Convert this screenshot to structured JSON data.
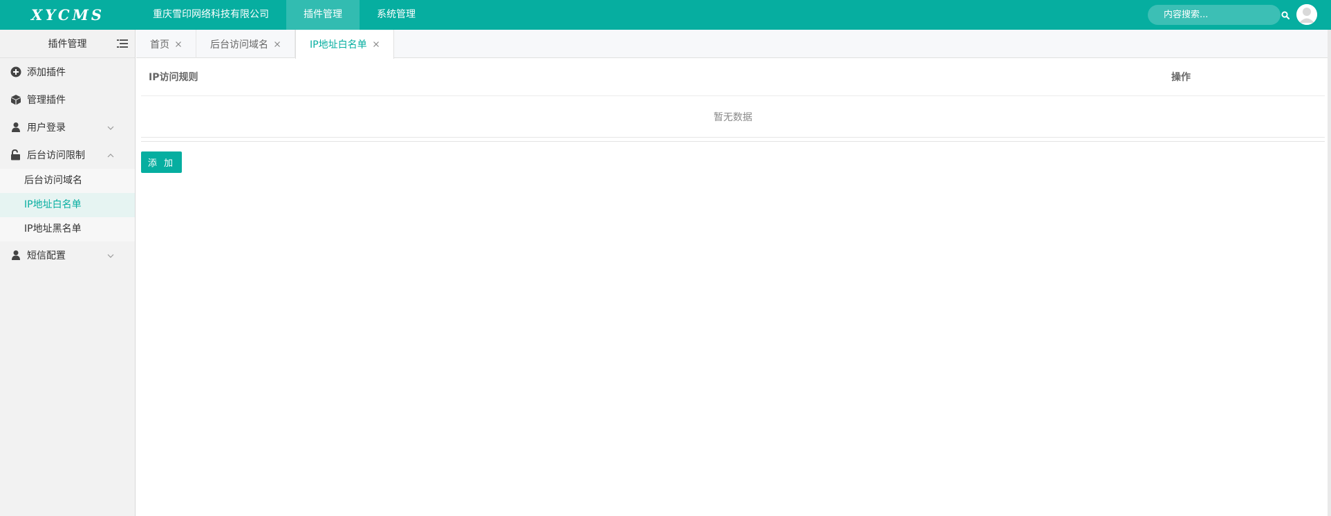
{
  "colors": {
    "accent": "#06AEA0",
    "sidebar_bg": "#F2F2F2"
  },
  "logo": {
    "text": "XYCMS"
  },
  "top_nav": [
    {
      "label": "重庆雪印网络科技有限公司",
      "active": false
    },
    {
      "label": "插件管理",
      "active": true
    },
    {
      "label": "系统管理",
      "active": false
    }
  ],
  "search": {
    "placeholder": "内容搜索...",
    "icon": "search-icon"
  },
  "user": {
    "icon": "user-avatar-icon"
  },
  "sidebar": {
    "title": "插件管理",
    "toggle_icon": "menu-toggle-icon",
    "items": [
      {
        "label": "添加插件",
        "icon": "plus-circle-icon"
      },
      {
        "label": "管理插件",
        "icon": "cube-icon"
      },
      {
        "label": "用户登录",
        "icon": "user-icon",
        "expanded": false
      },
      {
        "label": "后台访问限制",
        "icon": "unlock-icon",
        "expanded": true,
        "children": [
          {
            "label": "后台访问域名",
            "active": false
          },
          {
            "label": "IP地址白名单",
            "active": true
          },
          {
            "label": "IP地址黑名单",
            "active": false
          }
        ]
      },
      {
        "label": "短信配置",
        "icon": "user-icon",
        "expanded": false
      }
    ]
  },
  "tabs": [
    {
      "label": "首页",
      "active": false
    },
    {
      "label": "后台访问域名",
      "active": false
    },
    {
      "label": "IP地址白名单",
      "active": true
    }
  ],
  "table": {
    "columns": [
      "IP访问规则",
      "操作"
    ],
    "empty_text": "暂无数据"
  },
  "add_button": {
    "label": "添 加"
  }
}
